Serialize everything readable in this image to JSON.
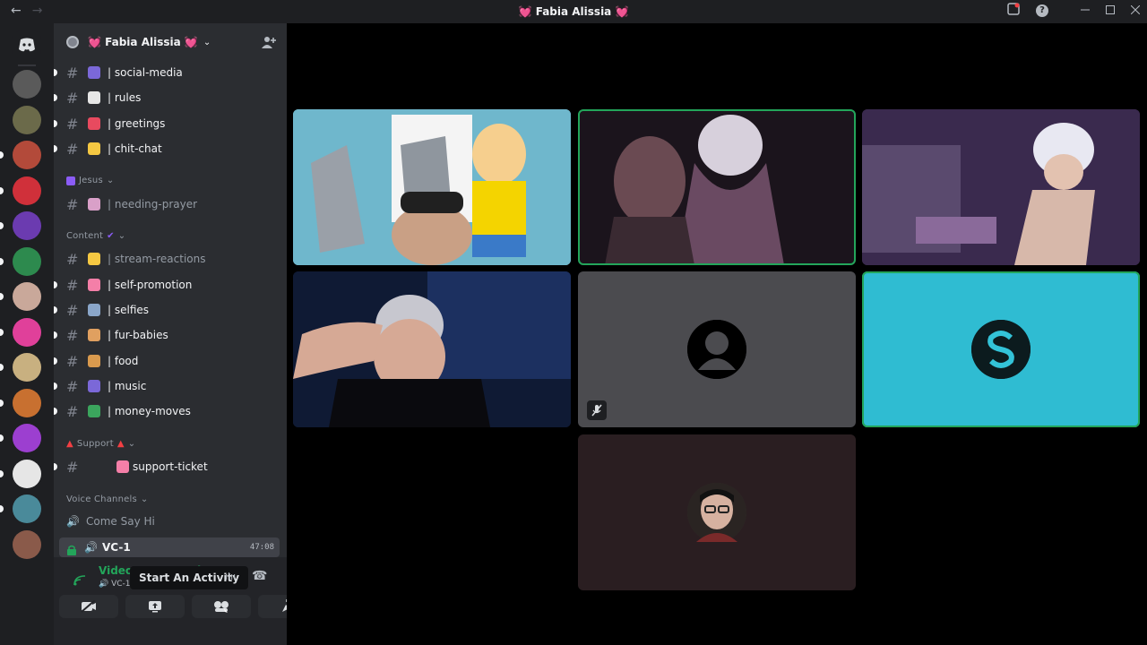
{
  "titlebar": {
    "back_icon": "arrow-left-icon",
    "forward_icon": "arrow-right-icon",
    "title": "💓 Fabia Alissia 💓",
    "inbox_icon": "inbox-icon",
    "help_icon": "help-icon",
    "help_glyph": "?",
    "minimize_icon": "minimize-icon",
    "maximize_icon": "maximize-icon",
    "close_icon": "close-icon"
  },
  "server": {
    "name": "💓 Fabia Alissia 💓",
    "chevron": "⌄",
    "invite_icon": "add-member-icon"
  },
  "channels": [
    {
      "label": "| social-media",
      "emoji_color": "#7b68d8"
    },
    {
      "label": "| rules",
      "emoji_color": "#e6e6e6"
    },
    {
      "label": "| greetings",
      "emoji_color": "#e84a5f"
    },
    {
      "label": "| chit-chat",
      "emoji_color": "#f5c842"
    }
  ],
  "categories": {
    "jesus": "Jesus",
    "content": "Content",
    "support": "Support",
    "voice": "Voice Channels"
  },
  "jesus_channels": [
    {
      "label": "| needing-prayer",
      "emoji_color": "#d9a0c8"
    }
  ],
  "content_channels": [
    {
      "label": "| stream-reactions",
      "emoji_color": "#f5c842",
      "muted": true
    },
    {
      "label": "| self-promotion",
      "emoji_color": "#f47fa8"
    },
    {
      "label": "| selfies",
      "emoji_color": "#8aa6c9"
    },
    {
      "label": "| fur-babies",
      "emoji_color": "#e0a060"
    },
    {
      "label": "| food",
      "emoji_color": "#d99a4e"
    },
    {
      "label": "| music",
      "emoji_color": "#7b68d8"
    },
    {
      "label": "| money-moves",
      "emoji_color": "#3ba55d"
    }
  ],
  "support_channels": [
    {
      "label": "support-ticket",
      "emoji_color": "#f47fa8"
    }
  ],
  "voice_channels": [
    {
      "label": "Come Say Hi"
    },
    {
      "label": "VC-1",
      "time": "47:08",
      "active": true
    }
  ],
  "rtc": {
    "status": "Video Connected",
    "sub": "🔊 VC-1 / 💓 Fabia Alissia",
    "tooltip": "Start An Activity",
    "buttons": [
      "camera-off-icon",
      "screen-share-icon",
      "activity-icon",
      "soundboard-icon"
    ],
    "wave_glyph": "ılıı",
    "hangup_glyph": "☎"
  },
  "tiles": [
    {
      "kind": "stream",
      "bg": "#7fc3d6",
      "speaking": false
    },
    {
      "kind": "stream",
      "bg": "#2a1f2b",
      "speaking": true
    },
    {
      "kind": "stream",
      "bg": "#3b2a4a",
      "speaking": false
    },
    {
      "kind": "stream",
      "bg": "#15203a",
      "speaking": false
    },
    {
      "kind": "avatar",
      "bg": "#4b4b4f",
      "avatar_color": "#000000",
      "muted_icon": "mic-muted-icon",
      "speaking": false
    },
    {
      "kind": "avatar",
      "bg": "#2fbcd2",
      "avatar_color": "#0c1b1e",
      "speaking": true
    },
    {
      "kind": "avatar",
      "bg": "#2a1e21",
      "avatar_color": "#3a3230",
      "speaking": false
    }
  ],
  "colors": {
    "accent_green": "#23a55a",
    "sidebar": "#2b2d31",
    "rail": "#1e1f22"
  }
}
